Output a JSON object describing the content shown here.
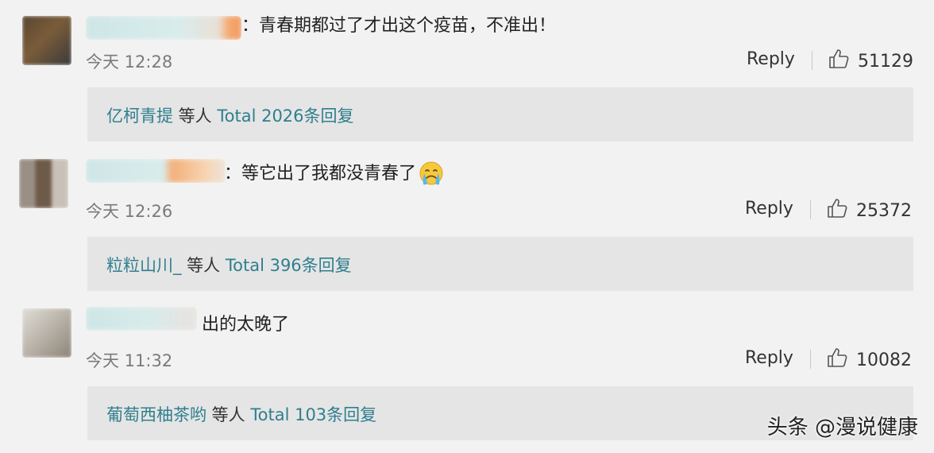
{
  "comments": [
    {
      "text": "：青春期都过了才出这个疫苗，不准出！",
      "time": "今天 12:28",
      "reply_label": "Reply",
      "likes": "51129",
      "replies": {
        "names": "亿柯青提",
        "suffix": " 等人 ",
        "total": "Total 2026条回复"
      }
    },
    {
      "text": "：等它出了我都没青春了",
      "emoji": "crying-face",
      "time": "今天 12:26",
      "reply_label": "Reply",
      "likes": "25372",
      "replies": {
        "names": "粒粒山川_",
        "suffix": " 等人 ",
        "total": "Total 396条回复"
      }
    },
    {
      "text": "出的太晚了",
      "time": "今天 11:32",
      "reply_label": "Reply",
      "likes": "10082",
      "replies": {
        "names": "葡萄西柚茶哟",
        "suffix": " 等人 ",
        "total": "Total 103条回复"
      }
    }
  ],
  "watermark": "头条 @漫说健康",
  "colors": {
    "background": "#f2f2f2",
    "reply_box": "#e5e5e5",
    "link": "#2f7f8e"
  }
}
